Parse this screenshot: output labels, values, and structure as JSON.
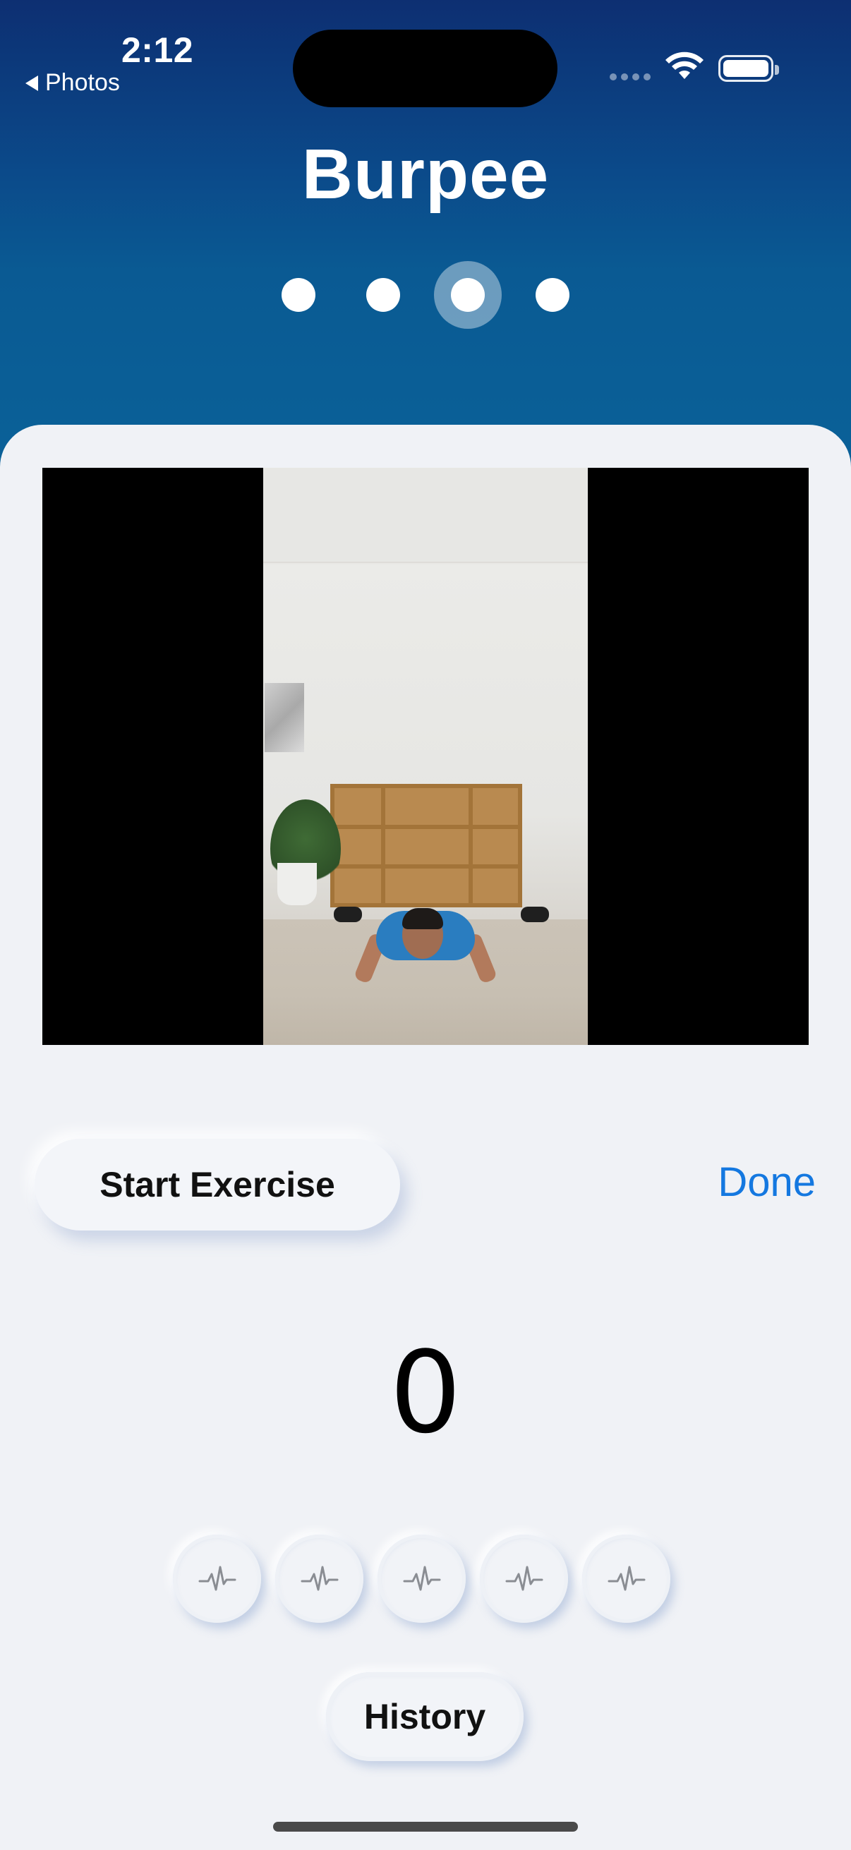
{
  "status_bar": {
    "time": "2:12",
    "back_label": "Photos"
  },
  "exercise": {
    "title": "Burpee",
    "page_count": 4,
    "active_page_index": 2
  },
  "controls": {
    "start_label": "Start Exercise",
    "done_label": "Done",
    "counter": "0",
    "history_label": "History"
  },
  "heart_buttons": [
    "heartbeat-icon",
    "heartbeat-icon",
    "heartbeat-icon",
    "heartbeat-icon",
    "heartbeat-icon"
  ],
  "colors": {
    "header_top": "#0d2f72",
    "header_bottom": "#0a6299",
    "accent_link": "#1478e0",
    "background": "#f0f2f6"
  }
}
